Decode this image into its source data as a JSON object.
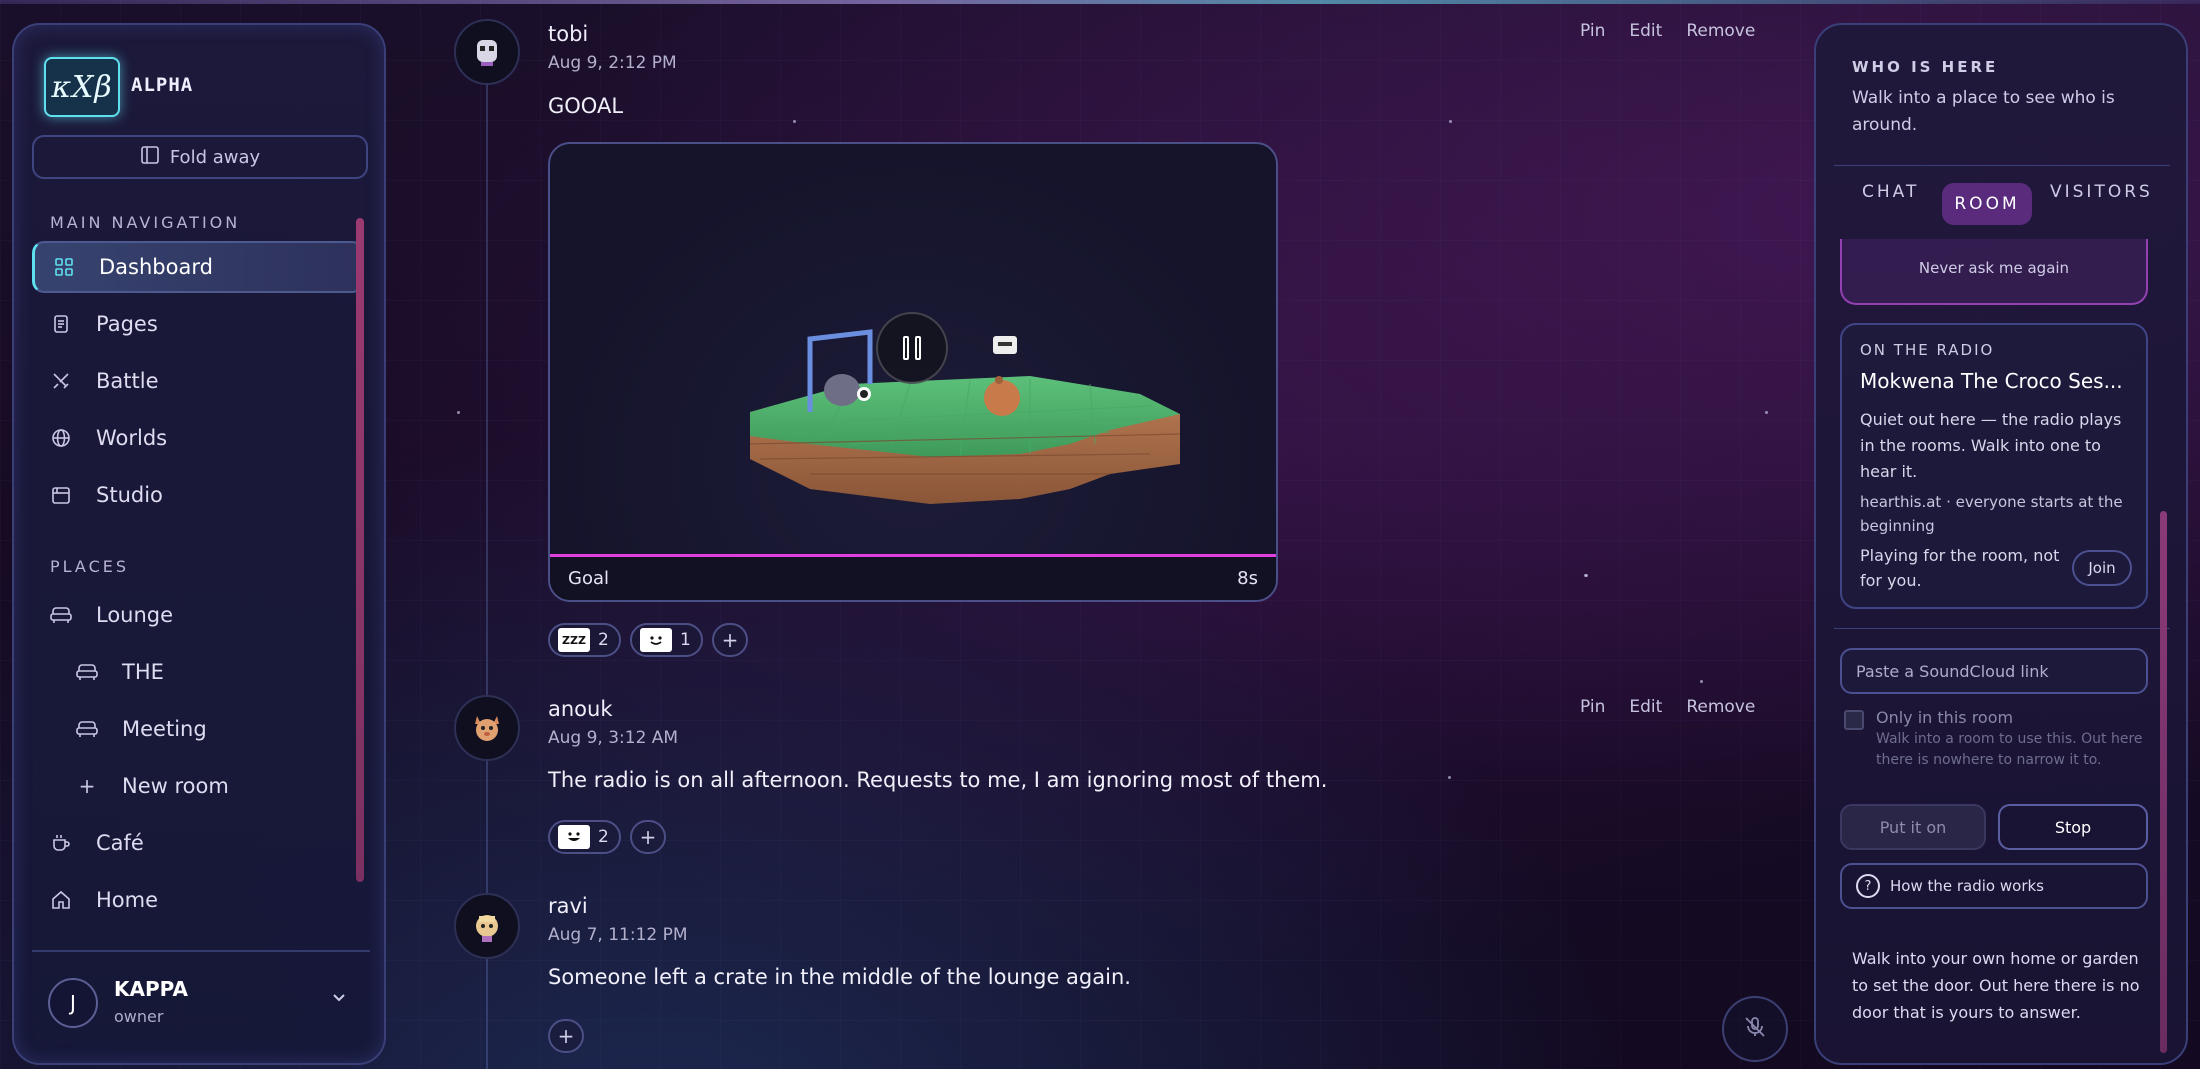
{
  "app": {
    "logo_text": "κXβ",
    "badge": "ALPHA"
  },
  "sidebar": {
    "fold_label": "Fold away",
    "main_nav_title": "MAIN NAVIGATION",
    "main_nav": [
      {
        "label": "Dashboard",
        "icon": "grid-icon",
        "active": true
      },
      {
        "label": "Pages",
        "icon": "document-icon"
      },
      {
        "label": "Battle",
        "icon": "swords-icon"
      },
      {
        "label": "Worlds",
        "icon": "globe-icon"
      },
      {
        "label": "Studio",
        "icon": "calendar-icon"
      }
    ],
    "places_title": "PLACES",
    "places": [
      {
        "label": "Lounge",
        "icon": "sofa-icon"
      },
      {
        "label": "THE",
        "icon": "sofa-icon",
        "sub": true
      },
      {
        "label": "Meeting",
        "icon": "sofa-icon",
        "sub": true
      },
      {
        "label": "New room",
        "icon": "plus-icon",
        "sub": true
      },
      {
        "label": "Café",
        "icon": "cup-icon"
      },
      {
        "label": "Home",
        "icon": "home-icon"
      }
    ],
    "user": {
      "initial": "J",
      "name": "KAPPA",
      "role": "owner"
    }
  },
  "feed": {
    "actions": {
      "pin": "Pin",
      "edit": "Edit",
      "remove": "Remove"
    },
    "messages": [
      {
        "author": "tobi",
        "time": "Aug 9, 2:12 PM",
        "text": "GOOAL",
        "video": {
          "caption": "Goal",
          "duration": "8s"
        },
        "reactions": [
          {
            "emoji": "zzz",
            "count": "2"
          },
          {
            "emoji": "smile",
            "count": "1"
          }
        ]
      },
      {
        "author": "anouk",
        "time": "Aug 9, 3:12 AM",
        "text": "The radio is on all afternoon. Requests to me, I am ignoring most of them.",
        "reactions": [
          {
            "emoji": "grin",
            "count": "2"
          }
        ]
      },
      {
        "author": "ravi",
        "time": "Aug 7, 11:12 PM",
        "text": "Someone left a crate in the middle of the lounge again.",
        "reactions": []
      }
    ]
  },
  "panel": {
    "title": "WHO IS HERE",
    "subtitle": "Walk into a place to see who is around.",
    "tabs": [
      "CHAT",
      "ROOM",
      "VISITORS"
    ],
    "active_tab": "ROOM",
    "never_ask": "Never ask me again",
    "radio": {
      "title": "ON THE RADIO",
      "song": "Mokwena The Croco Ses...",
      "body": "Quiet out here — the radio plays in the rooms. Walk into one to hear it.",
      "source": "hearthis.at · everyone starts at the beginning",
      "playing": "Playing for the room, not for you.",
      "join": "Join"
    },
    "soundcloud_placeholder": "Paste a SoundCloud link",
    "only_room_label": "Only in this room",
    "only_room_help": "Walk into a room to use this. Out here there is nowhere to narrow it to.",
    "put_on": "Put it on",
    "stop": "Stop",
    "how_radio": "How the radio works",
    "door_text": "Walk into your own home or garden to set the door. Out here there is no door that is yours to answer."
  },
  "colors": {
    "accent": "#5ee0ee",
    "magenta": "#e040e0",
    "tab_active": "#5a2b7c"
  }
}
